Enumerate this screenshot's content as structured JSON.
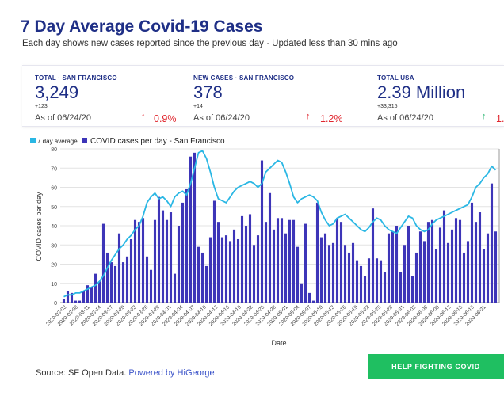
{
  "header": {
    "title": "7 Day Average Covid-19 Cases",
    "subtitle": "Each day shows new cases reported since the previous day · Updated less than 30 mins ago"
  },
  "stats": [
    {
      "label": "TOTAL · SAN FRANCISCO",
      "value": "3,249",
      "delta": "+123",
      "date": "As of 06/24/20",
      "arrow": "↑",
      "pct": "0.9%",
      "trend_color": "#e0262e"
    },
    {
      "label": "NEW CASES · SAN FRANCISCO",
      "value": "378",
      "delta": "+14",
      "date": "As of 06/24/20",
      "arrow": "↑",
      "pct": "1.2%",
      "trend_color": "#e0262e"
    },
    {
      "label": "TOTAL USA",
      "value": "2.39 Million",
      "delta": "+33,315",
      "date": "As of 06/24/20",
      "arrow": "↑",
      "pct": "1.",
      "trend_color": "#2bb673"
    }
  ],
  "chart_data": {
    "type": "bar",
    "xlabel": "Date",
    "ylabel": "COVID cases per day",
    "ylim": [
      0,
      80
    ],
    "yticks": [
      0,
      10,
      20,
      30,
      40,
      50,
      60,
      70,
      80
    ],
    "grid": true,
    "legend_position": "top-left",
    "tick_labels": [
      "2020-03-03",
      "2020-03-08",
      "2020-03-11",
      "2020-03-14",
      "2020-03-17",
      "2020-03-20",
      "2020-03-23",
      "2020-03-26",
      "2020-03-29",
      "2020-04-01",
      "2020-04-04",
      "2020-04-07",
      "2020-04-10",
      "2020-04-13",
      "2020-04-16",
      "2020-04-19",
      "2020-04-22",
      "2020-04-25",
      "2020-04-28",
      "2020-05-01",
      "2020-05-04",
      "2020-05-07",
      "2020-05-10",
      "2020-05-13",
      "2020-05-16",
      "2020-05-19",
      "2020-05-22",
      "2020-05-25",
      "2020-05-28",
      "2020-05-31",
      "2020-06-03",
      "2020-06-06",
      "2020-06-09",
      "2020-06-12",
      "2020-06-15",
      "2020-06-18",
      "2020-06-21"
    ],
    "series": [
      {
        "name": "COVID cases per day - San Francisco",
        "kind": "bar",
        "color": "#3d35b8",
        "values": [
          2,
          6,
          5,
          1,
          1,
          6,
          9,
          8,
          15,
          11,
          41,
          26,
          21,
          19,
          36,
          21,
          24,
          33,
          43,
          42,
          44,
          24,
          17,
          43,
          55,
          48,
          43,
          47,
          15,
          40,
          52,
          59,
          76,
          78,
          29,
          26,
          19,
          34,
          53,
          42,
          34,
          35,
          32,
          38,
          33,
          45,
          40,
          46,
          30,
          35,
          74,
          42,
          57,
          38,
          44,
          44,
          36,
          43,
          43,
          29,
          10,
          41,
          5,
          1,
          52,
          34,
          36,
          30,
          31,
          44,
          42,
          30,
          26,
          31,
          22,
          19,
          14,
          23,
          49,
          23,
          22,
          16,
          36,
          37,
          40,
          16,
          30,
          40,
          14,
          26,
          37,
          32,
          42,
          43,
          28,
          39,
          48,
          31,
          38,
          44,
          43,
          26,
          32,
          52,
          42,
          47,
          28,
          36,
          62,
          37
        ]
      },
      {
        "name": "7 day average",
        "kind": "line",
        "color": "#2ab7e4",
        "values": [
          3,
          4,
          4,
          5,
          5,
          6,
          7,
          8,
          9,
          11,
          14,
          18,
          22,
          25,
          28,
          30,
          33,
          35,
          38,
          40,
          45,
          52,
          55,
          57,
          54,
          55,
          53,
          50,
          55,
          57,
          58,
          56,
          62,
          70,
          78,
          79,
          75,
          68,
          60,
          54,
          53,
          52,
          55,
          58,
          60,
          61,
          62,
          63,
          62,
          60,
          62,
          68,
          70,
          72,
          74,
          73,
          68,
          62,
          55,
          52,
          54,
          55,
          56,
          55,
          53,
          47,
          43,
          40,
          41,
          44,
          45,
          46,
          44,
          42,
          40,
          38,
          37,
          39,
          42,
          44,
          43,
          40,
          38,
          37,
          36,
          39,
          42,
          45,
          44,
          40,
          38,
          37,
          38,
          41,
          43,
          44,
          45,
          46,
          47,
          48,
          49,
          50,
          51,
          55,
          60,
          62,
          65,
          67,
          71,
          69
        ]
      }
    ]
  },
  "footer": {
    "source_text": "Source: SF Open Data.",
    "powered_text": "Powered by HiGeorge"
  },
  "cta": {
    "label": "HELP FIGHTING COVID"
  }
}
